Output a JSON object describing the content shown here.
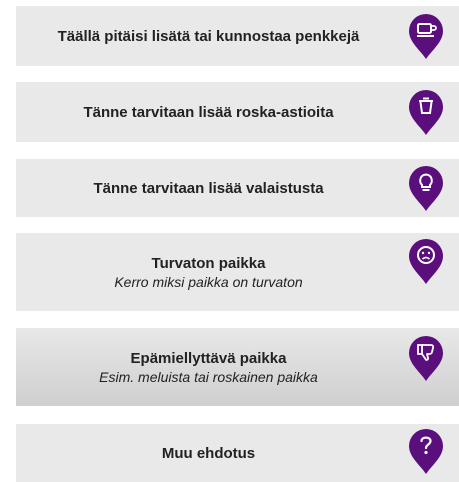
{
  "options": [
    {
      "title": "Täällä pitäisi lisätä tai kunnostaa penkkejä",
      "icon": "bench-icon"
    },
    {
      "title": "Tänne tarvitaan lisää roska-astioita",
      "icon": "trash-bin-icon"
    },
    {
      "title": "Tänne tarvitaan lisää valaistusta",
      "icon": "lightbulb-icon"
    },
    {
      "title": "Turvaton paikka",
      "subtitle": "Kerro miksi paikka on turvaton",
      "icon": "sad-face-icon"
    },
    {
      "title": "Epämiellyttävä paikka",
      "subtitle": "Esim. meluista tai roskainen paikka",
      "icon": "thumbs-down-icon"
    },
    {
      "title": "Muu ehdotus",
      "icon": "question-mark-icon"
    }
  ],
  "colors": {
    "pin": "#5b0f7d",
    "card": "#e9e9e9",
    "text": "#222222"
  }
}
